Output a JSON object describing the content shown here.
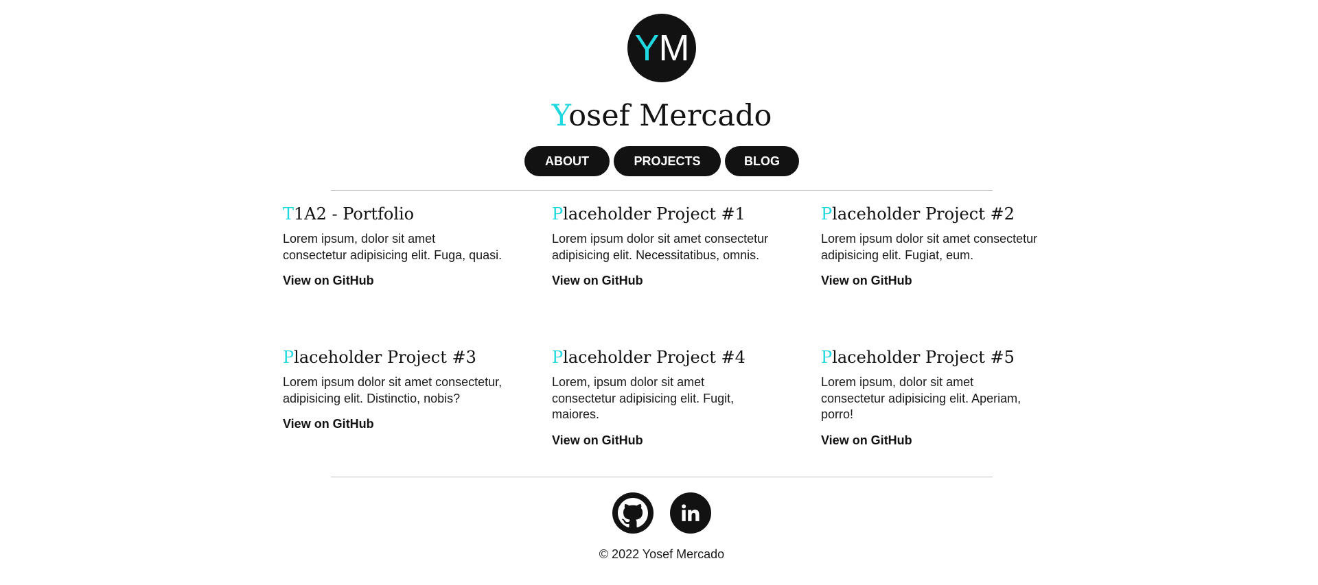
{
  "header": {
    "logo": {
      "accent": "Y",
      "rest": "M"
    },
    "title": {
      "accent": "Y",
      "rest": "osef Mercado"
    }
  },
  "nav": [
    {
      "label": "ABOUT"
    },
    {
      "label": "PROJECTS"
    },
    {
      "label": "BLOG"
    }
  ],
  "projects": [
    {
      "title_accent": "T",
      "title_rest": "1A2 - Portfolio",
      "description": "Lorem ipsum, dolor sit amet consectetur adipisicing elit. Fuga, quasi.",
      "link": "View on GitHub"
    },
    {
      "title_accent": "P",
      "title_rest": "laceholder Project #1",
      "description": "Lorem ipsum dolor sit amet consectetur adipisicing elit. Necessitatibus, omnis.",
      "link": "View on GitHub"
    },
    {
      "title_accent": "P",
      "title_rest": "laceholder Project #2",
      "description": "Lorem ipsum dolor sit amet consectetur adipisicing elit. Fugiat, eum.",
      "link": "View on GitHub"
    },
    {
      "title_accent": "P",
      "title_rest": "laceholder Project #3",
      "description": "Lorem ipsum dolor sit amet consectetur, adipisicing elit. Distinctio, nobis?",
      "link": "View on GitHub"
    },
    {
      "title_accent": "P",
      "title_rest": "laceholder Project #4",
      "description": "Lorem, ipsum dolor sit amet consectetur adipisicing elit. Fugit, maiores.",
      "link": "View on GitHub"
    },
    {
      "title_accent": "P",
      "title_rest": "laceholder Project #5",
      "description": "Lorem ipsum, dolor sit amet consectetur adipisicing elit. Aperiam, porro!",
      "link": "View on GitHub"
    }
  ],
  "footer": {
    "social_icons": [
      "github-icon",
      "linkedin-icon"
    ],
    "copyright": "© 2022 Yosef Mercado"
  },
  "colors": {
    "accent": "#1fd8e0",
    "dark": "#121212",
    "divider": "#bdbdbd",
    "background": "#ffffff"
  }
}
